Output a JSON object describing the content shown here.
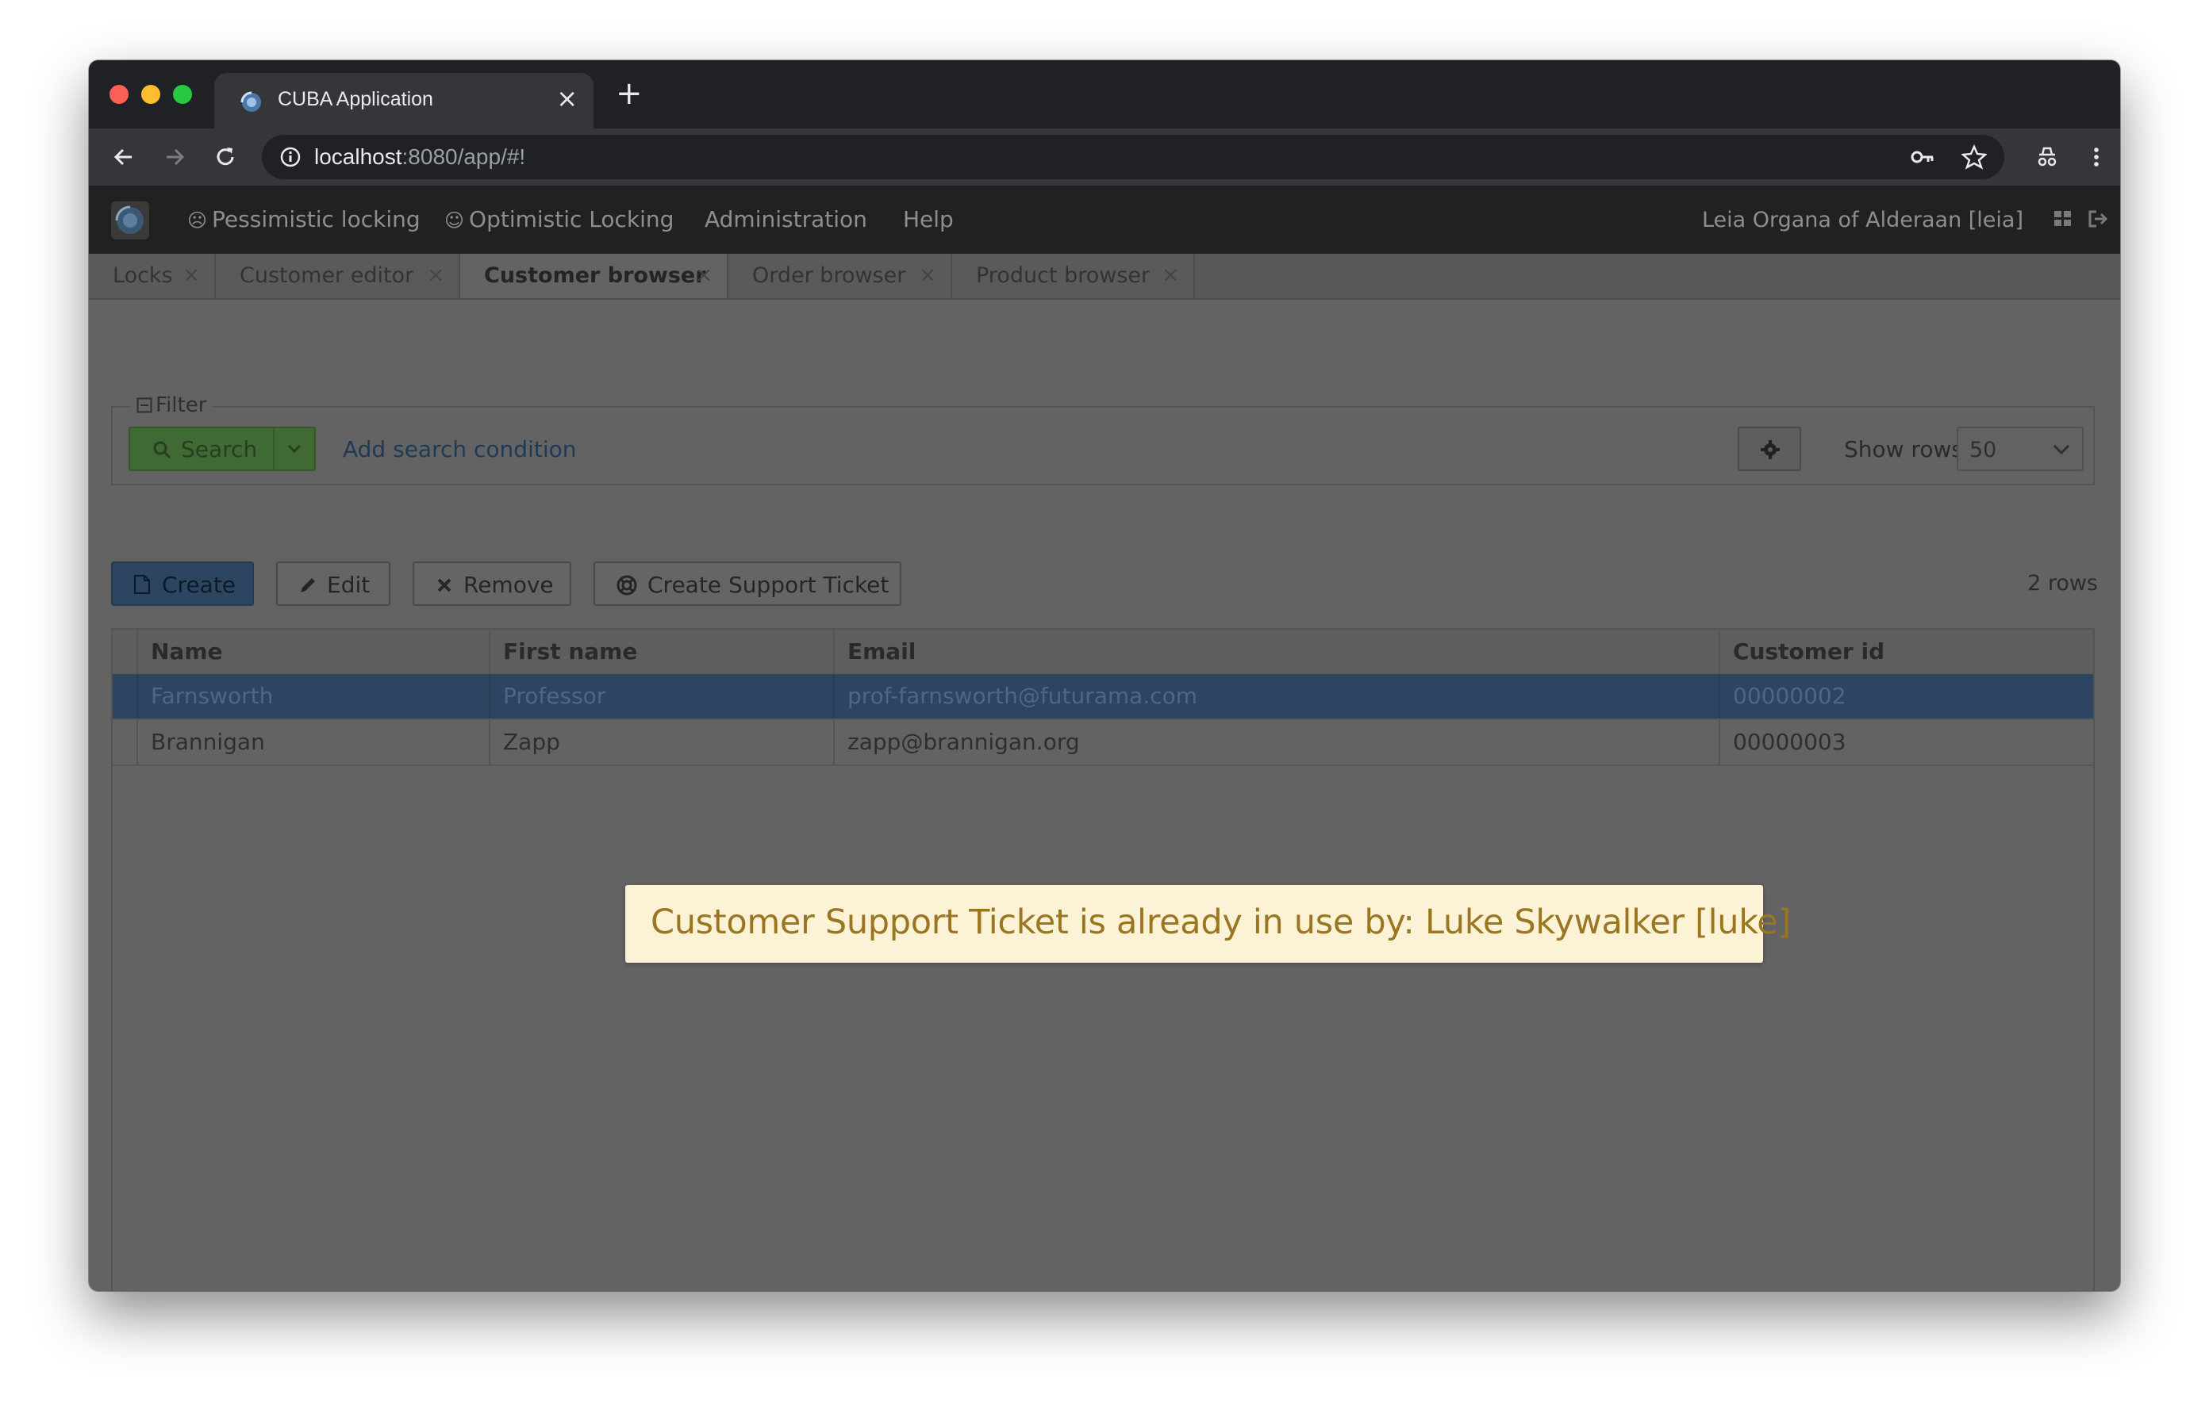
{
  "browser": {
    "tab_title": "CUBA Application",
    "tab_close": "×",
    "new_tab": "+",
    "url_host": "localhost",
    "url_path": ":8080/app/#!"
  },
  "menubar": {
    "items": [
      {
        "label": "Pessimistic locking",
        "icon": "frown-icon"
      },
      {
        "label": "Optimistic Locking",
        "icon": "smile-icon"
      },
      {
        "label": "Administration"
      },
      {
        "label": "Help"
      }
    ],
    "user": "Leia Organa of Alderaan [leia]"
  },
  "worktabs": [
    {
      "label": "Locks",
      "close": "×"
    },
    {
      "label": "Customer editor",
      "close": "×"
    },
    {
      "label": "Customer browser",
      "close": "×",
      "active": true
    },
    {
      "label": "Order browser",
      "close": "×"
    },
    {
      "label": "Product browser",
      "close": "×"
    }
  ],
  "filter": {
    "legend": "Filter",
    "search_label": "Search",
    "add_condition": "Add search condition",
    "show_rows_label": "Show rows",
    "show_rows_value": "50"
  },
  "actions": {
    "create": "Create",
    "edit": "Edit",
    "remove": "Remove",
    "support_ticket": "Create Support Ticket",
    "rows_count": "2 rows"
  },
  "table": {
    "columns": [
      "Name",
      "First name",
      "Email",
      "Customer id"
    ],
    "rows": [
      [
        "Farnsworth",
        "Professor",
        "prof-farnsworth@futurama.com",
        "00000002"
      ],
      [
        "Brannigan",
        "Zapp",
        "zapp@brannigan.org",
        "00000003"
      ]
    ]
  },
  "notification": "Customer Support Ticket is already in use by: Luke Skywalker [luke]",
  "colors": {
    "accent": "#2d4560",
    "search_green": "#3f6a34",
    "notification_bg": "#fcf3d7",
    "notification_text": "#9b7620"
  }
}
